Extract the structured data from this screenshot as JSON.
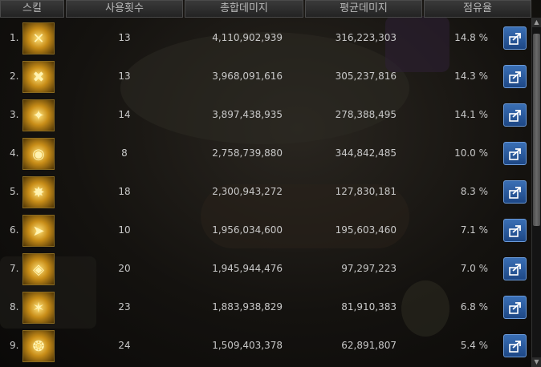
{
  "headers": {
    "skill": "스킬",
    "count": "사용횟수",
    "total": "총합데미지",
    "avg": "평균데미지",
    "share": "점유율"
  },
  "rows": [
    {
      "num": "1.",
      "icon": "skill-1-icon",
      "count": "13",
      "total": "4,110,902,939",
      "avg": "316,223,303",
      "share": "14.8 %"
    },
    {
      "num": "2.",
      "icon": "skill-2-icon",
      "count": "13",
      "total": "3,968,091,616",
      "avg": "305,237,816",
      "share": "14.3 %"
    },
    {
      "num": "3.",
      "icon": "skill-3-icon",
      "count": "14",
      "total": "3,897,438,935",
      "avg": "278,388,495",
      "share": "14.1 %"
    },
    {
      "num": "4.",
      "icon": "skill-4-icon",
      "count": "8",
      "total": "2,758,739,880",
      "avg": "344,842,485",
      "share": "10.0 %"
    },
    {
      "num": "5.",
      "icon": "skill-5-icon",
      "count": "18",
      "total": "2,300,943,272",
      "avg": "127,830,181",
      "share": "8.3 %"
    },
    {
      "num": "6.",
      "icon": "skill-6-icon",
      "count": "10",
      "total": "1,956,034,600",
      "avg": "195,603,460",
      "share": "7.1 %"
    },
    {
      "num": "7.",
      "icon": "skill-7-icon",
      "count": "20",
      "total": "1,945,944,476",
      "avg": "97,297,223",
      "share": "7.0 %"
    },
    {
      "num": "8.",
      "icon": "skill-8-icon",
      "count": "23",
      "total": "1,883,938,829",
      "avg": "81,910,383",
      "share": "6.8 %"
    },
    {
      "num": "9.",
      "icon": "skill-9-icon",
      "count": "24",
      "total": "1,509,403,378",
      "avg": "62,891,807",
      "share": "5.4 %"
    }
  ],
  "share_button_icon": "share-icon",
  "colors": {
    "header_bg": "#2e2e2e",
    "text": "#c8c8c8",
    "share_button": "#2a5ba0",
    "icon_gold": "#d9a02a"
  }
}
